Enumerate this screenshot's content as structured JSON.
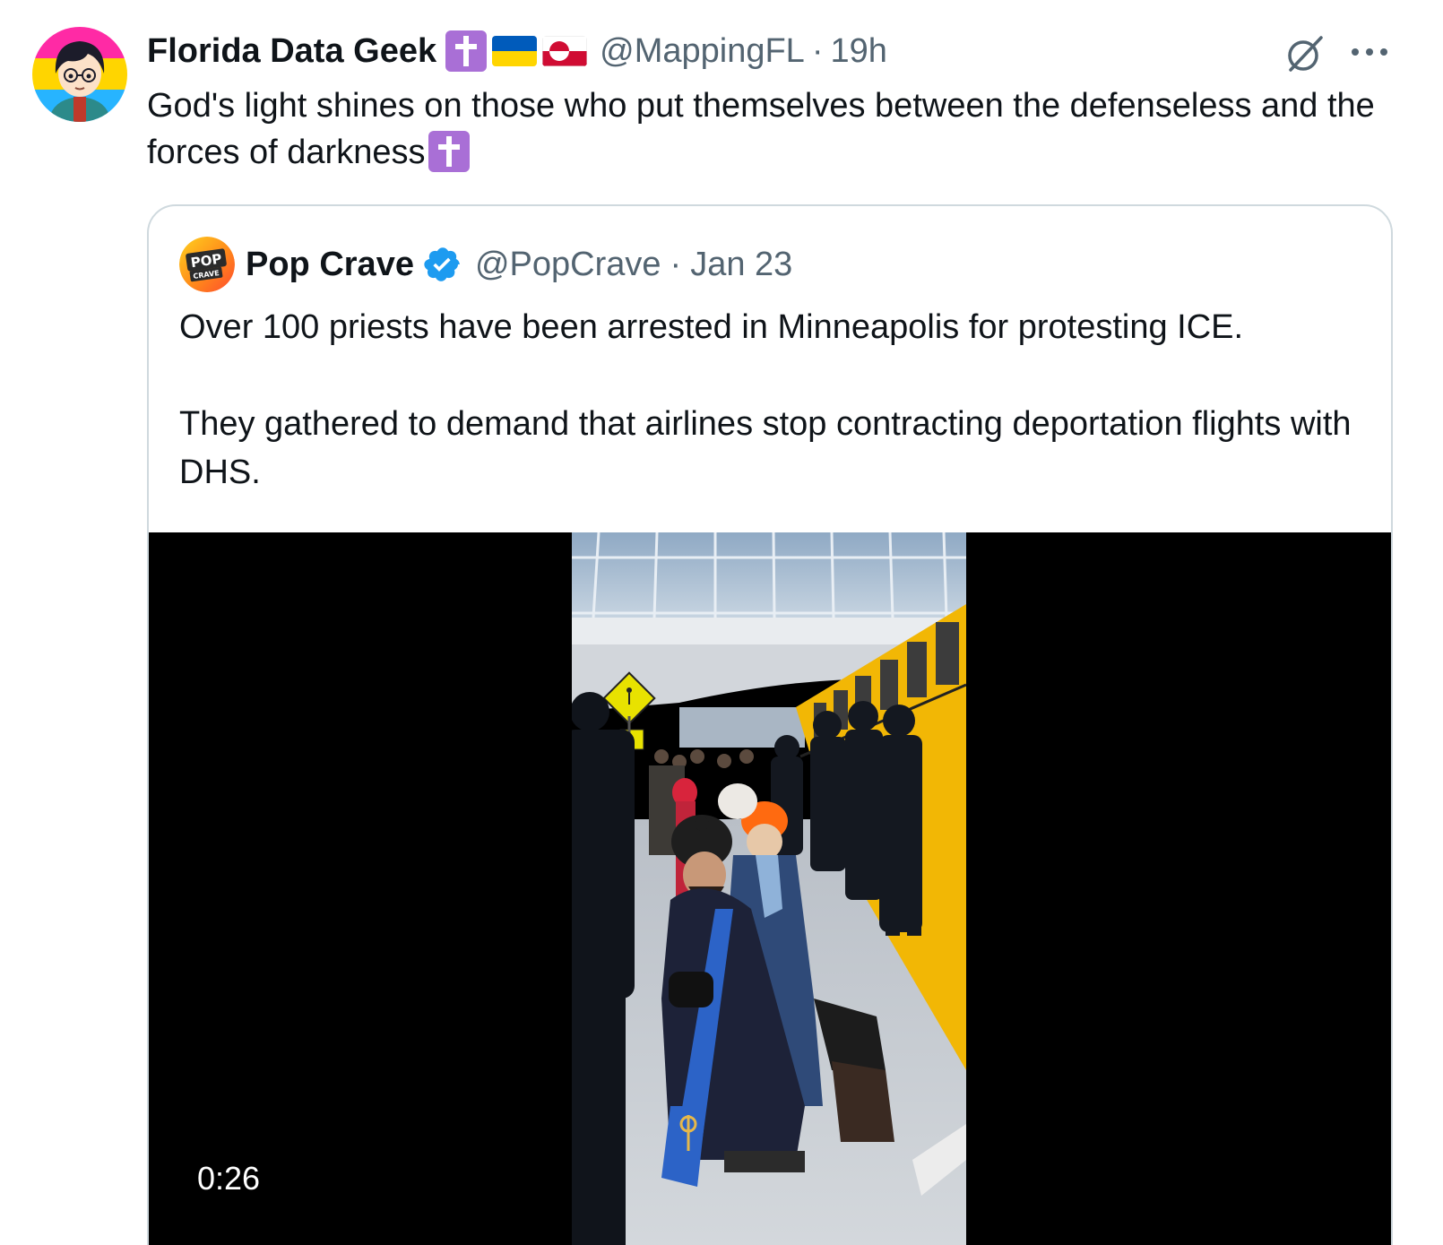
{
  "author": {
    "display_name": "Florida Data Geek",
    "handle": "@MappingFL",
    "separator": "·",
    "time": "19h",
    "avatar_icon": "cartoon-avatar-icon",
    "badges": [
      "latin-cross-emoji",
      "ukraine-flag-emoji",
      "greenland-flag-emoji"
    ]
  },
  "tweet": {
    "text": "God's light shines on those who put themselves between the defenseless and the forces of darkness"
  },
  "actions": {
    "grok_icon": "grok-icon",
    "more_icon": "more-icon"
  },
  "quote": {
    "display_name": "Pop Crave",
    "handle": "@PopCrave",
    "separator": "·",
    "time": "Jan 23",
    "verified_icon": "verified-badge-icon",
    "avatar_logo_text": "POP CRAVE",
    "text_p1": "Over 100 priests have been arrested in Minneapolis for protesting ICE.",
    "text_p2": "They gathered to demand that airlines stop contracting deportation flights with DHS.",
    "media": {
      "duration": "0:26"
    }
  },
  "colors": {
    "text_primary": "#0f1419",
    "text_secondary": "#536471",
    "border": "#cfd9de",
    "verified_blue": "#1d9bf0",
    "cross_purple": "#a96fd6"
  }
}
